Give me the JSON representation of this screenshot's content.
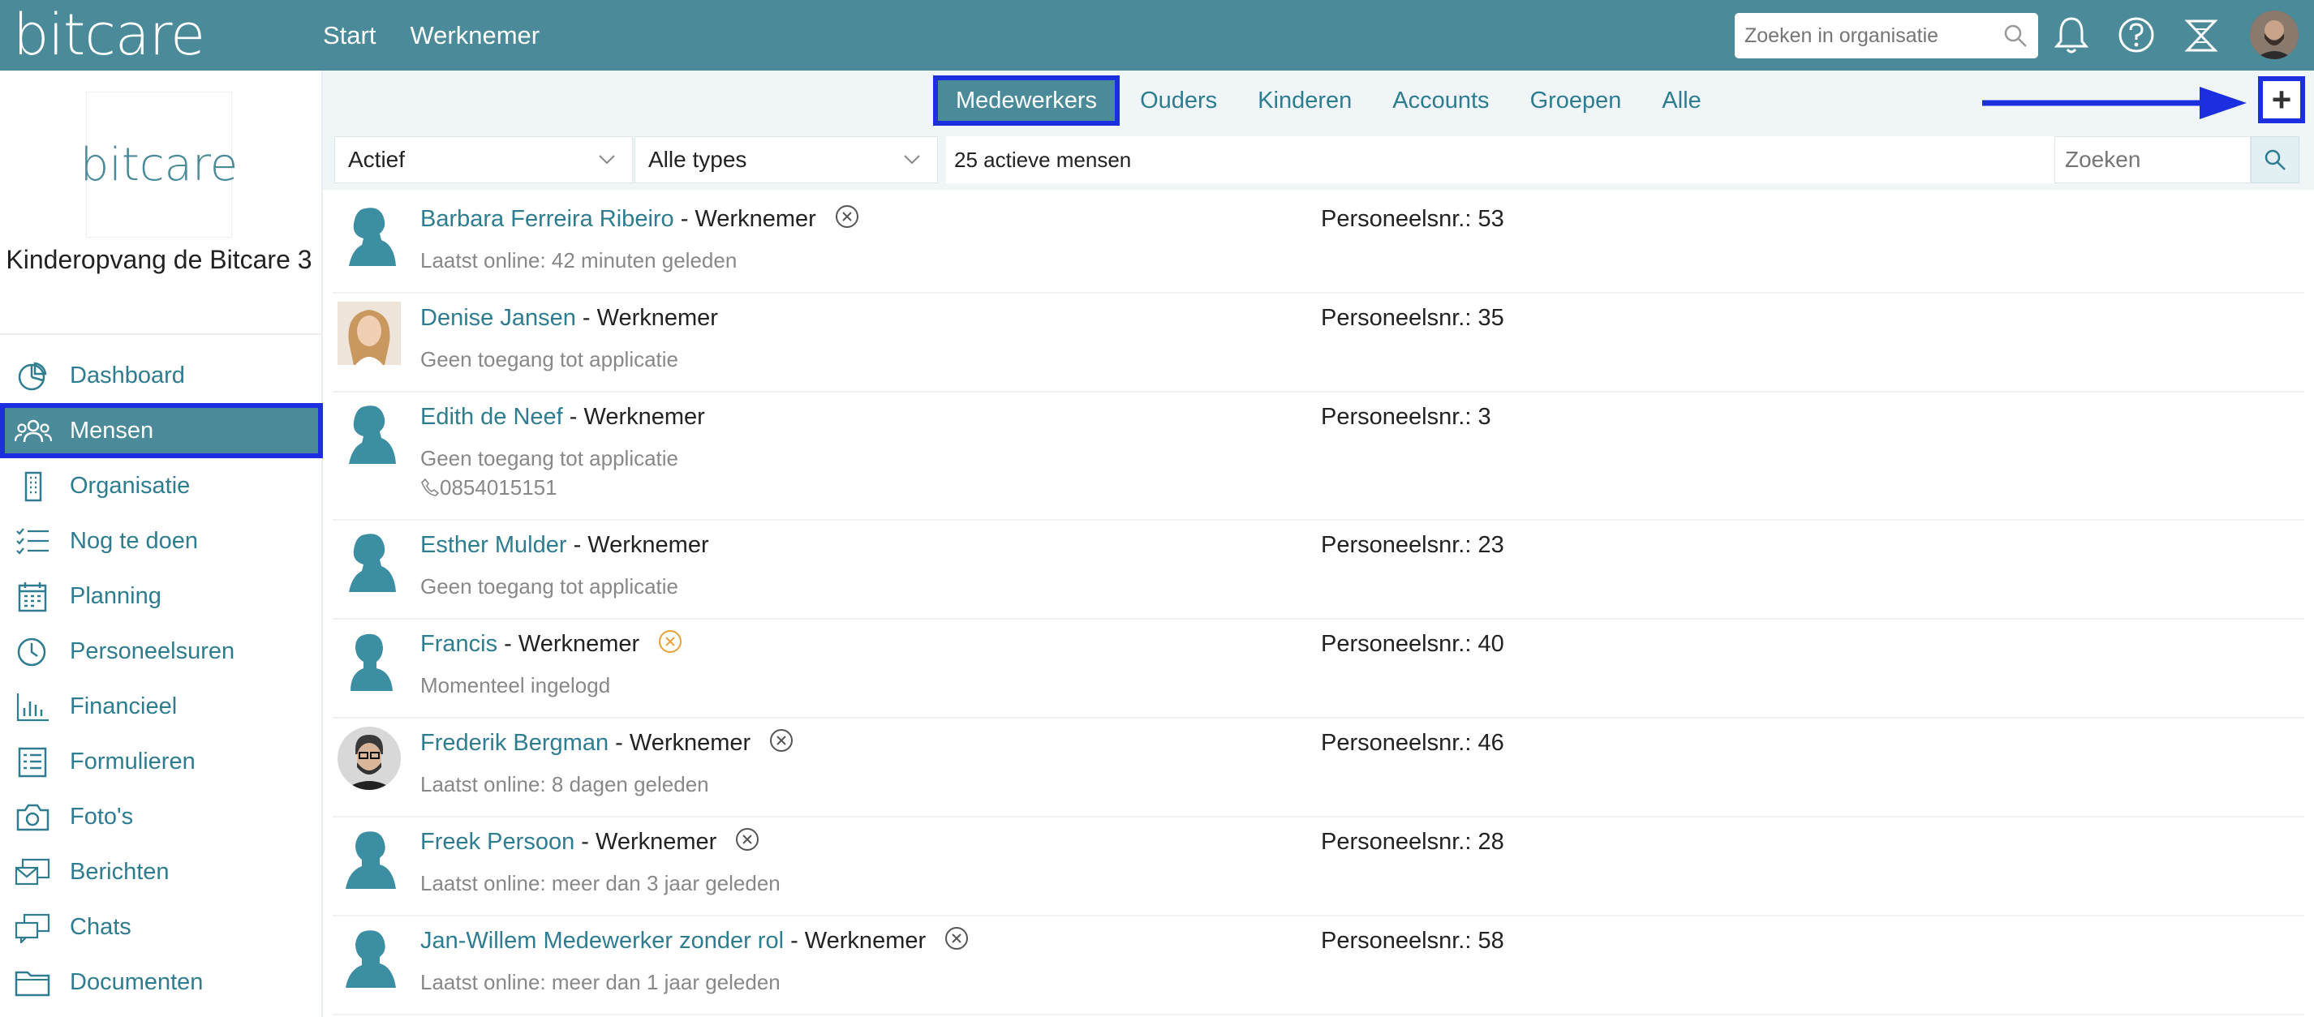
{
  "app": {
    "logo": "bitcare"
  },
  "topnav": {
    "start": "Start",
    "werknemer": "Werknemer"
  },
  "top_search": {
    "placeholder": "Zoeken in organisatie"
  },
  "top_icons": [
    "bell-icon",
    "help-icon",
    "switch-icon",
    "user-avatar"
  ],
  "sidebar": {
    "org_logo": "bitcare",
    "org_name": "Kinderopvang de Bitcare 3",
    "items": [
      {
        "label": "Dashboard",
        "icon": "dashboard-icon"
      },
      {
        "label": "Mensen",
        "icon": "people-icon",
        "active": true
      },
      {
        "label": "Organisatie",
        "icon": "building-icon"
      },
      {
        "label": "Nog te doen",
        "icon": "checklist-icon"
      },
      {
        "label": "Planning",
        "icon": "calendar-icon"
      },
      {
        "label": "Personeelsuren",
        "icon": "clock-icon"
      },
      {
        "label": "Financieel",
        "icon": "bar-chart-icon"
      },
      {
        "label": "Formulieren",
        "icon": "form-icon"
      },
      {
        "label": "Foto's",
        "icon": "camera-icon"
      },
      {
        "label": "Berichten",
        "icon": "messages-icon"
      },
      {
        "label": "Chats",
        "icon": "chats-icon"
      },
      {
        "label": "Documenten",
        "icon": "folder-icon"
      }
    ]
  },
  "tabs": [
    {
      "label": "Medewerkers",
      "active": true
    },
    {
      "label": "Ouders"
    },
    {
      "label": "Kinderen"
    },
    {
      "label": "Accounts"
    },
    {
      "label": "Groepen"
    },
    {
      "label": "Alle"
    }
  ],
  "add_button": {
    "label": "+"
  },
  "filters": {
    "status": "Actief",
    "type": "Alle types",
    "count_text": "25 actieve mensen",
    "search_placeholder": "Zoeken"
  },
  "colors": {
    "brand": "#4b8a98",
    "link": "#2e7c90",
    "highlight": "#1b2fe0",
    "warning": "#e8a23a"
  },
  "people": [
    {
      "name": "Barbara Ferreira Ribeiro",
      "role": " - Werknemer",
      "status": "Laatst online: 42 minuten geleden",
      "pnr": "Personeelsnr.: 53",
      "x_icon": true,
      "avatar": "female-silhouette"
    },
    {
      "name": "Denise Jansen",
      "role": " - Werknemer",
      "status": "Geen toegang tot applicatie",
      "pnr": "Personeelsnr.: 35",
      "x_icon": false,
      "avatar": "photo-female"
    },
    {
      "name": "Edith de Neef",
      "role": " - Werknemer",
      "status": "Geen toegang tot applicatie",
      "phone": "0854015151",
      "pnr": "Personeelsnr.: 3",
      "x_icon": false,
      "avatar": "female-silhouette"
    },
    {
      "name": "Esther Mulder",
      "role": " - Werknemer",
      "status": "Geen toegang tot applicatie",
      "pnr": "Personeelsnr.: 23",
      "x_icon": false,
      "avatar": "female-silhouette"
    },
    {
      "name": "Francis",
      "role": " - Werknemer",
      "status": "Momenteel ingelogd",
      "pnr": "Personeelsnr.: 40",
      "x_icon": true,
      "x_warning": true,
      "avatar": "neutral-silhouette"
    },
    {
      "name": "Frederik Bergman",
      "role": " - Werknemer",
      "status": "Laatst online: 8 dagen geleden",
      "pnr": "Personeelsnr.: 46",
      "x_icon": true,
      "avatar": "photo-male"
    },
    {
      "name": "Freek Persoon",
      "role": " - Werknemer",
      "status": "Laatst online: meer dan 3 jaar geleden",
      "pnr": "Personeelsnr.: 28",
      "x_icon": true,
      "avatar": "male-silhouette"
    },
    {
      "name": "Jan-Willem Medewerker zonder rol",
      "role": " - Werknemer",
      "status": "Laatst online: meer dan 1 jaar geleden",
      "pnr": "Personeelsnr.: 58",
      "x_icon": true,
      "avatar": "male-silhouette"
    }
  ]
}
